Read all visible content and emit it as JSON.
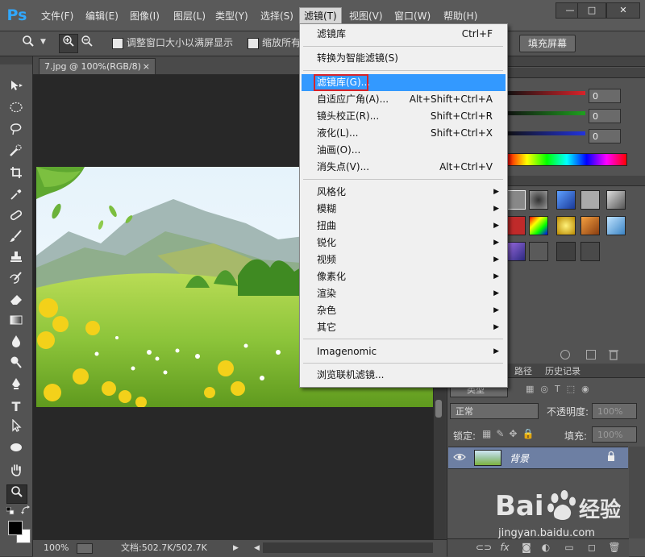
{
  "menubar": {
    "logo": "Ps",
    "items": [
      "文件(F)",
      "编辑(E)",
      "图像(I)",
      "图层(L)",
      "类型(Y)",
      "选择(S)",
      "滤镜(T)",
      "视图(V)",
      "窗口(W)",
      "帮助(H)"
    ],
    "window_controls": [
      "—",
      "□",
      "✕"
    ]
  },
  "options": {
    "resize_windows_label": "调整窗口大小以满屏显示",
    "zoom_all_label": "缩放所有",
    "fill_screen_label": "填充屏幕"
  },
  "document": {
    "tab_title": "7.jpg @ 100%(RGB/8)",
    "tab_close": "×",
    "zoom": "100%",
    "doc_info": "文档:502.7K/502.7K",
    "status_arrow": "▶",
    "status_left_arrow": "◀"
  },
  "filter_menu": {
    "items": [
      {
        "label": "滤镜库",
        "shortcut": "Ctrl+F"
      },
      {
        "label": "转换为智能滤镜(S)",
        "shortcut": ""
      },
      {
        "label": "滤镜库(G)...",
        "shortcut": ""
      },
      {
        "label": "自适应广角(A)...",
        "shortcut": "Alt+Shift+Ctrl+A"
      },
      {
        "label": "镜头校正(R)...",
        "shortcut": "Shift+Ctrl+R"
      },
      {
        "label": "液化(L)...",
        "shortcut": "Shift+Ctrl+X"
      },
      {
        "label": "油画(O)...",
        "shortcut": ""
      },
      {
        "label": "消失点(V)...",
        "shortcut": "Alt+Ctrl+V"
      },
      {
        "label": "风格化",
        "shortcut": ""
      },
      {
        "label": "模糊",
        "shortcut": ""
      },
      {
        "label": "扭曲",
        "shortcut": ""
      },
      {
        "label": "锐化",
        "shortcut": ""
      },
      {
        "label": "视频",
        "shortcut": ""
      },
      {
        "label": "像素化",
        "shortcut": ""
      },
      {
        "label": "渲染",
        "shortcut": ""
      },
      {
        "label": "杂色",
        "shortcut": ""
      },
      {
        "label": "其它",
        "shortcut": ""
      },
      {
        "label": "Imagenomic",
        "shortcut": ""
      },
      {
        "label": "浏览联机滤镜...",
        "shortcut": ""
      }
    ],
    "submenu_arrow": "▶",
    "highlighted": "滤镜库(G)..."
  },
  "color_panel": {
    "r": "0",
    "g": "0",
    "b": "0",
    "colors": {
      "red": "#d8232a",
      "green": "#1ea01e",
      "blue": "#2233dd"
    }
  },
  "layers_panel": {
    "tabs": [
      "路径",
      "历史记录"
    ],
    "filter_kind": "类型",
    "blend_mode": "正常",
    "opacity_label": "不透明度:",
    "opacity_value": "100%",
    "lock_label": "锁定:",
    "fill_label": "填充:",
    "fill_value": "100%",
    "layer_name": "背景"
  },
  "watermark": {
    "brand": "Bai",
    "brand2": "经验",
    "url": "jingyan.baidu.com"
  }
}
